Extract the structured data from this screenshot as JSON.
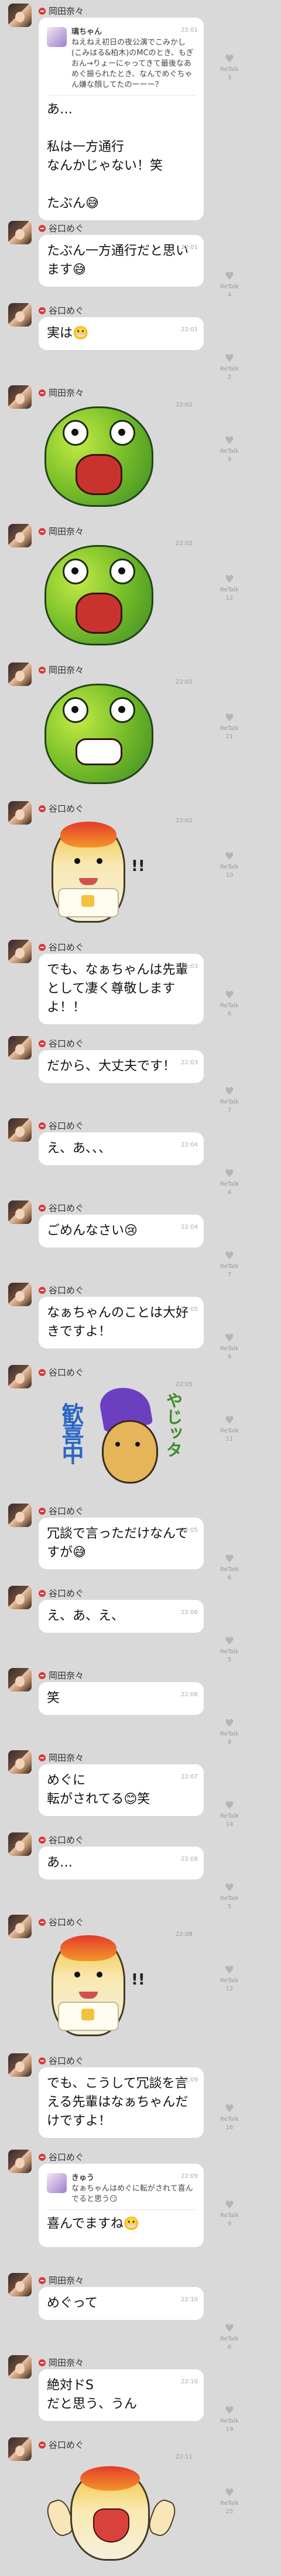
{
  "colors": {
    "background": "#d9d9d9",
    "bubble": "#ffffff",
    "badge": "#d83a3a"
  },
  "reaction_label": "ReTalk",
  "messages": [
    {
      "sender": "岡田奈々",
      "time": "22:01",
      "text": "あ…\n\n私は一方通行\nなんかじゃない！笑\n\nたぶん😅",
      "reply": {
        "author": "璃ちゃん",
        "text": "ねえねえ初日の夜公演でこみかし(こみはる&柏木)のMCのとき、もぎおん→りょーにゃってきて最後なあめぐ振られたとき、なんでめぐちゃん嫌な顔してたのーーー？"
      },
      "reacts": "3"
    },
    {
      "sender": "谷口めぐ",
      "time": "22:01",
      "text": "たぶん一方通行だと思います😅",
      "reacts": "4"
    },
    {
      "sender": "谷口めぐ",
      "time": "22:01",
      "text": "実は😬",
      "reacts": "2"
    },
    {
      "sender": "岡田奈々",
      "time": "22:02",
      "sticker": "frog-crying",
      "reacts": "9"
    },
    {
      "sender": "岡田奈々",
      "time": "22:02",
      "sticker": "frog-shouting",
      "reacts": "12"
    },
    {
      "sender": "岡田奈々",
      "time": "22:02",
      "sticker": "frog-teeth",
      "reacts": "21"
    },
    {
      "sender": "谷口めぐ",
      "time": "22:02",
      "sticker": "yam-shocked",
      "reacts": "10"
    },
    {
      "sender": "谷口めぐ",
      "time": "22:03",
      "text": "でも、なぁちゃんは先輩として凄く尊敬しますよ！！",
      "reacts": "6"
    },
    {
      "sender": "谷口めぐ",
      "time": "22:03",
      "text": "だから、大丈夫です！",
      "reacts": "7"
    },
    {
      "sender": "谷口めぐ",
      "time": "22:04",
      "text": "え、あ、、、",
      "reacts": "4"
    },
    {
      "sender": "谷口めぐ",
      "time": "22:04",
      "text": "ごめんなさい😢",
      "reacts": "7"
    },
    {
      "sender": "谷口めぐ",
      "time": "22:05",
      "text": "なぁちゃんのことは大好きですよ！",
      "reacts": "9"
    },
    {
      "sender": "谷口めぐ",
      "time": "22:05",
      "sticker": "purple-cheer",
      "sticker_text": [
        "歓喜中",
        "やじッタ"
      ],
      "reacts": "11"
    },
    {
      "sender": "谷口めぐ",
      "time": "22:05",
      "text": "冗談で言っただけなんですが😅",
      "reacts": "6"
    },
    {
      "sender": "谷口めぐ",
      "time": "22:06",
      "text": "え、あ、え、",
      "reacts": "5"
    },
    {
      "sender": "岡田奈々",
      "time": "22:06",
      "text": "笑",
      "reacts": "8"
    },
    {
      "sender": "岡田奈々",
      "time": "22:07",
      "text": "めぐに\n転がされてる😊笑",
      "reacts": "14"
    },
    {
      "sender": "谷口めぐ",
      "time": "22:08",
      "text": "あ…",
      "reacts": "5"
    },
    {
      "sender": "谷口めぐ",
      "time": "22:08",
      "sticker": "yam-shocked",
      "reacts": "12"
    },
    {
      "sender": "谷口めぐ",
      "time": "22:09",
      "text": "でも、こうして冗談を言える先輩はなぁちゃんだけですよ！",
      "reacts": "16"
    },
    {
      "sender": "谷口めぐ",
      "time": "22:09",
      "text": "喜んでますね😬",
      "reply": {
        "author": "きゅう",
        "text": "なぁちゃんはめぐに転がされて喜んでると思う😏"
      },
      "reacts": "9"
    },
    {
      "sender": "岡田奈々",
      "time": "22:10",
      "text": "めぐって",
      "reacts": "6"
    },
    {
      "sender": "岡田奈々",
      "time": "22:10",
      "text": "絶対ドS\nだと思う、うん",
      "reacts": "19"
    },
    {
      "sender": "谷口めぐ",
      "time": "22:11",
      "sticker": "yam-laughing",
      "reacts": "25"
    }
  ]
}
